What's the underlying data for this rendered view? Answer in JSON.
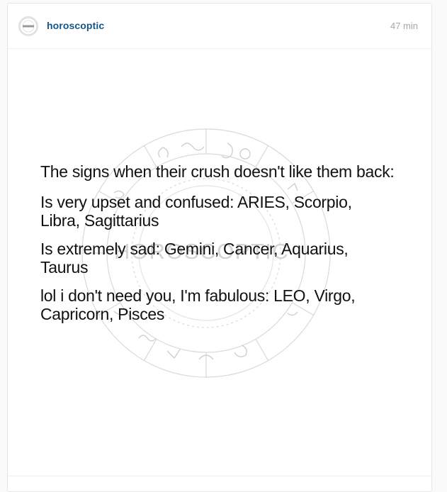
{
  "post": {
    "username": "horoscoptic",
    "timestamp": "47 min",
    "avatar_label": "HOROSCOPTIC",
    "image": {
      "watermark": "HOROSCOPTIC",
      "title_line": "The signs when their crush doesn't like them back:",
      "group1_line1": "Is very upset and confused: ARIES, Scorpio,",
      "group1_line2": "Libra, Sagittarius",
      "group2_line1": "Is extremely sad: Gemini, Cancer, Aquarius,",
      "group2_line2": "Taurus",
      "group3_line1": "lol i don't need you, I'm fabulous: LEO, Virgo,",
      "group3_line2": "Capricorn, Pisces"
    }
  }
}
